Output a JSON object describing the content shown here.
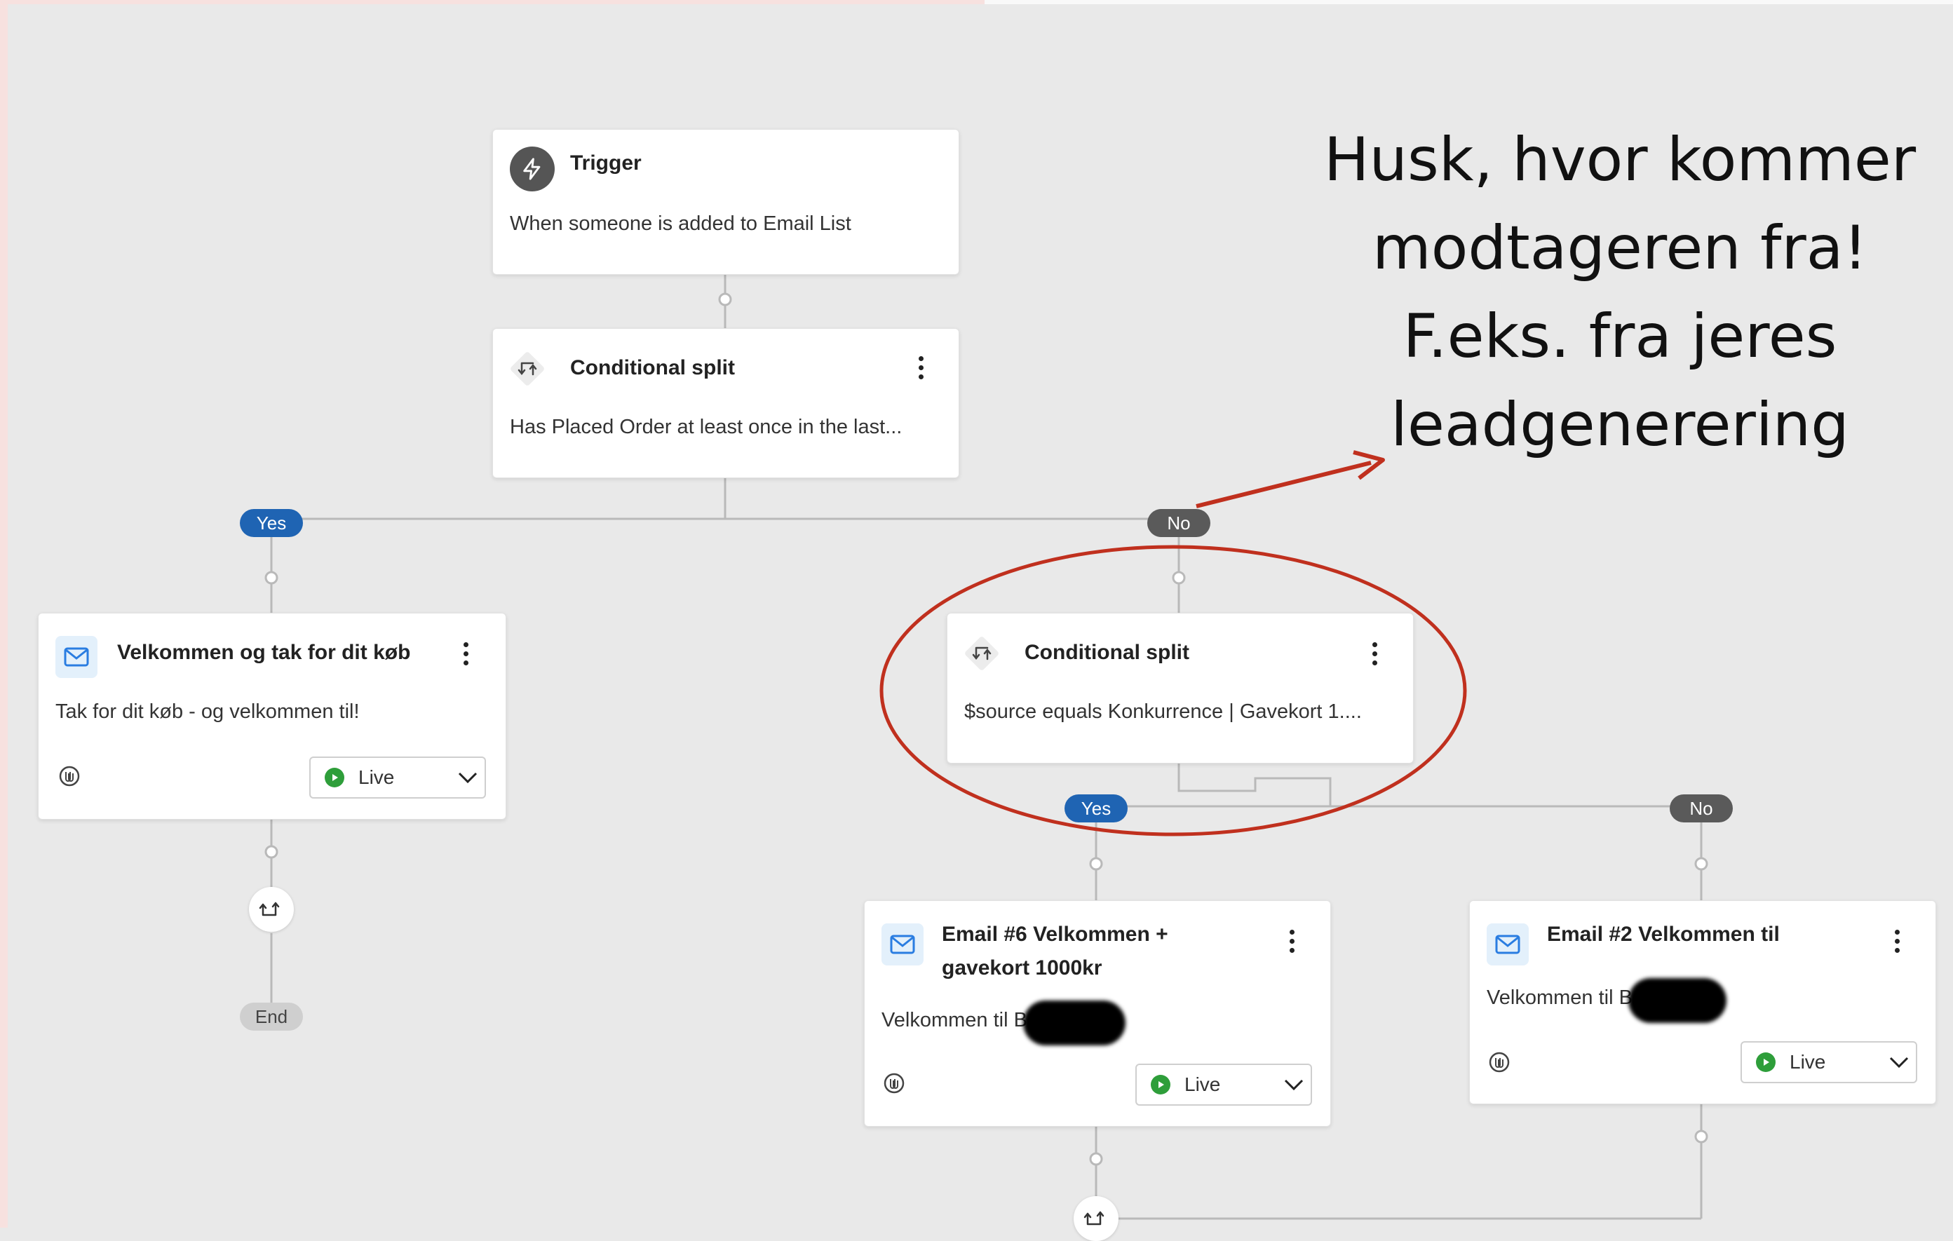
{
  "annotation": {
    "lines": [
      "Husk, hvor kommer",
      "modtageren fra!",
      "F.eks. fra jeres",
      "leadgenerering"
    ],
    "highlight_color": "#c0301e"
  },
  "trigger": {
    "icon": "lightning-icon",
    "title": "Trigger",
    "description": "When someone is added to Email List"
  },
  "split1": {
    "icon": "split-icon",
    "title": "Conditional split",
    "description": "Has Placed Order at least once in the last..."
  },
  "split1_branches": {
    "yes": "Yes",
    "no": "No"
  },
  "email_left": {
    "icon": "mail-icon",
    "title": "Velkommen og tak for dit køb",
    "description": "Tak for dit køb - og velkommen til!",
    "status": "Live"
  },
  "end_label": "End",
  "split2": {
    "icon": "split-icon",
    "title": "Conditional split",
    "description": "$source equals Konkurrence | Gavekort 1...."
  },
  "split2_branches": {
    "yes": "Yes",
    "no": "No"
  },
  "email6": {
    "icon": "mail-icon",
    "title_line1": "Email #6 Velkommen +",
    "title_line2": "gavekort 1000kr",
    "description": "Velkommen til B",
    "status": "Live"
  },
  "email2": {
    "icon": "mail-icon",
    "title": "Email #2 Velkommen til",
    "description": "Velkommen til B",
    "status": "Live"
  },
  "colors": {
    "yes_pill": "#1f64b3",
    "no_pill": "#5a5a5a",
    "live_dot": "#2e9e3a",
    "canvas": "#e9e9e9"
  }
}
